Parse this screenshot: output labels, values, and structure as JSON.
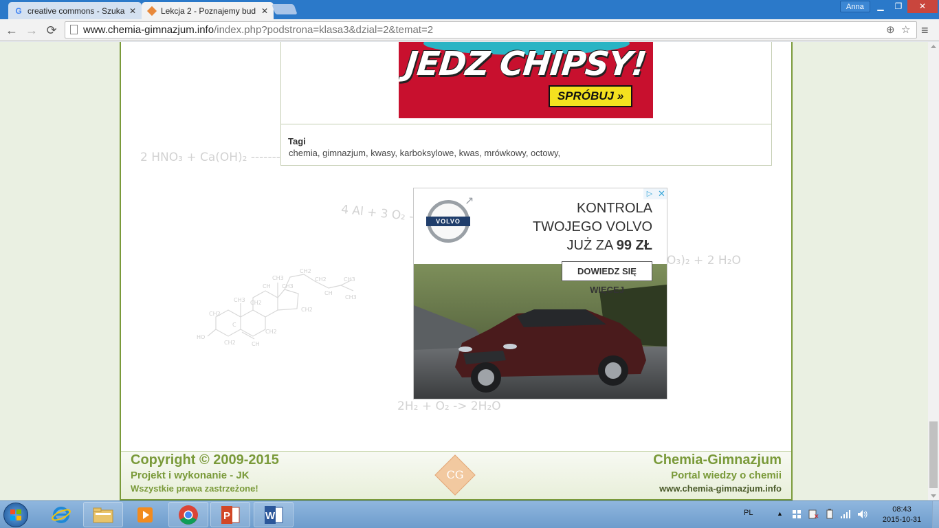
{
  "browser": {
    "tabs": [
      {
        "label": "creative commons - Szuka",
        "active": false
      },
      {
        "label": "Lekcja 2 - Poznajemy bud",
        "active": true
      }
    ],
    "user": "Anna",
    "url_host": "www.chemia-gimnazjum.info",
    "url_path": "/index.php?podstrona=klasa3&dzial=2&temat=2"
  },
  "ad_banner": {
    "headline": "JEDZ CHIPSY!",
    "cta": "SPRÓBUJ »"
  },
  "tags": {
    "title": "Tagi",
    "items": "chemia, gimnazjum, kwasy, karboksylowe, kwas, mrówkowy, octowy,"
  },
  "background_formulas": {
    "f1": "2 HNO₃ +   Ca(OH)₂ -------",
    "f2": "4 Al + 3 O₂ ->",
    "f3": "O₃)₂ +  2 H₂O",
    "f4": "2H₂ + O₂ -> 2H₂O"
  },
  "ad_volvo": {
    "brand": "VOLVO",
    "line1": "KONTROLA",
    "line2": "TWOJEGO VOLVO",
    "line3_prefix": "JUŻ ZA ",
    "line3_price": "99 ZŁ",
    "cta": "DOWIEDZ SIĘ WIĘCEJ"
  },
  "footer": {
    "copyright": "Copyright © 2009-2015",
    "project": "Projekt i wykonanie - JK",
    "rights": "Wszystkie prawa zastrzeżone!",
    "brand": "Chemia-Gimnazjum",
    "portal": "Portal wiedzy o chemii",
    "url": "www.chemia-gimnazjum.info",
    "logo_text": "CG"
  },
  "taskbar": {
    "language": "PL",
    "time": "08:43",
    "date": "2015-10-31"
  },
  "colors": {
    "site_green": "#7a9a3a",
    "tabstrip": "#2b79c9",
    "ad_red": "#c8102e",
    "ad_yellow": "#f4e11f"
  },
  "icons": [
    "google-favicon",
    "site-favicon",
    "back-icon",
    "forward-icon",
    "reload-icon",
    "page-icon",
    "zoom-icon",
    "star-icon",
    "menu-icon",
    "windows-start-icon",
    "ie-icon",
    "explorer-icon",
    "media-player-icon",
    "chrome-icon",
    "powerpoint-icon",
    "word-icon",
    "flag-icon",
    "network-icon",
    "volume-icon"
  ]
}
